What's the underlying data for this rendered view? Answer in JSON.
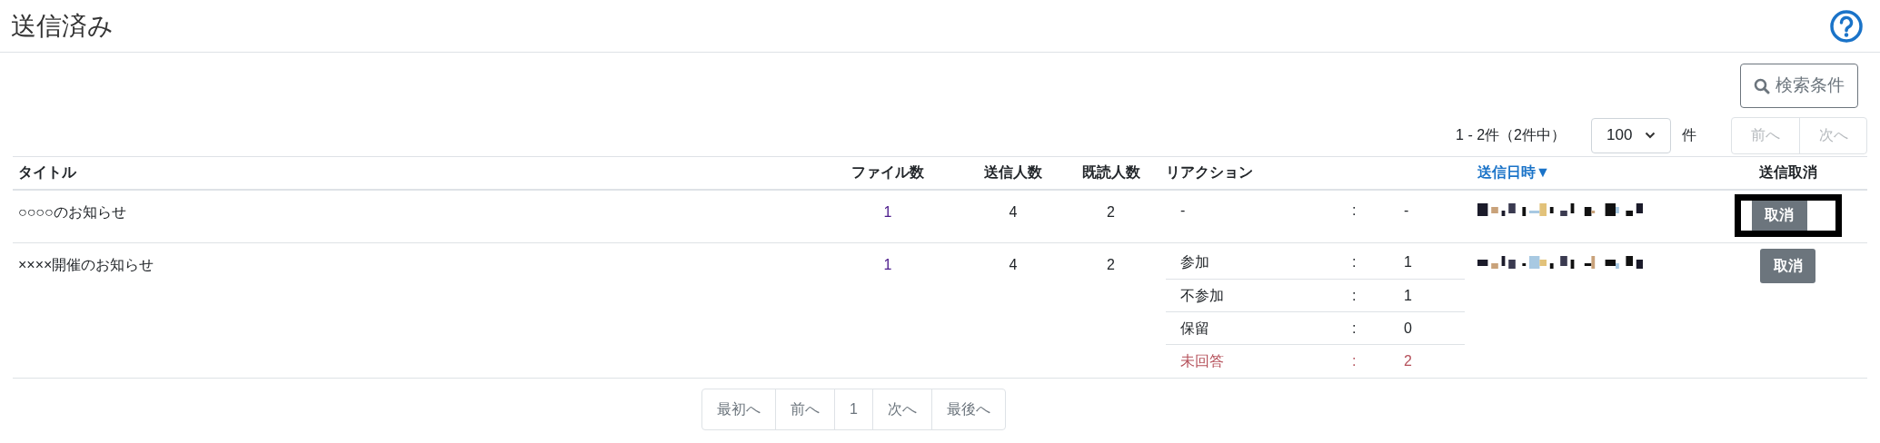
{
  "page": {
    "title": "送信済み"
  },
  "search_button": {
    "label": "検索条件"
  },
  "pager_top": {
    "summary": "1 - 2件（2件中）",
    "per_page": "100",
    "per_page_unit": "件",
    "buttons": [
      {
        "label": "前へ",
        "disabled": true
      },
      {
        "label": "次へ",
        "disabled": true
      }
    ]
  },
  "table": {
    "columns": [
      {
        "label": "タイトル",
        "sortable": false
      },
      {
        "label": "ファイル数",
        "sortable": false
      },
      {
        "label": "送信人数",
        "sortable": false
      },
      {
        "label": "既読人数",
        "sortable": false
      },
      {
        "label": "リアクション",
        "sortable": false
      },
      {
        "label": "送信日時▼",
        "sortable": true
      },
      {
        "label": "送信取消",
        "sortable": false
      }
    ],
    "rows": [
      {
        "title": "○○○○のお知らせ",
        "files": "1",
        "senders": "4",
        "readers": "2",
        "reactions": [
          {
            "kind": "normal",
            "label": "-",
            "colon": ":",
            "count": "-"
          }
        ],
        "cancel": "取消",
        "highlighted": true
      },
      {
        "title": "××××開催のお知らせ",
        "files": "1",
        "senders": "4",
        "readers": "2",
        "reactions": [
          {
            "kind": "normal",
            "label": "参加",
            "colon": ":",
            "count": "1"
          },
          {
            "kind": "normal",
            "label": "不参加",
            "colon": ":",
            "count": "1"
          },
          {
            "kind": "normal",
            "label": "保留",
            "colon": ":",
            "count": "0"
          },
          {
            "kind": "unanswered",
            "label": "未回答",
            "colon": ":",
            "count": "2"
          }
        ],
        "cancel": "取消",
        "highlighted": false
      }
    ]
  },
  "pagination": [
    {
      "label": "最初へ"
    },
    {
      "label": "前へ"
    },
    {
      "label": "1"
    },
    {
      "label": "次へ"
    },
    {
      "label": "最後へ"
    }
  ]
}
